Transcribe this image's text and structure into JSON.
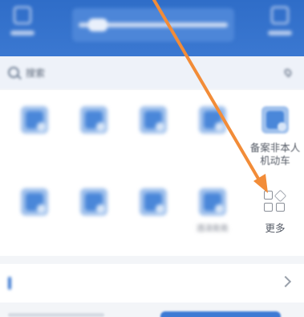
{
  "header": {
    "left_label": "",
    "right_label": "",
    "pill_text": ""
  },
  "search": {
    "placeholder": "搜索",
    "location": ""
  },
  "services": {
    "row1": [
      {
        "label": "",
        "icon": "doc-icon"
      },
      {
        "label": "",
        "icon": "car-icon"
      },
      {
        "label": "",
        "icon": "license-icon"
      },
      {
        "label": "",
        "icon": "report-icon"
      },
      {
        "label": "备案非本人机动车",
        "icon": "vehicle-record-icon"
      }
    ],
    "row2": [
      {
        "label": "",
        "icon": "calendar-icon"
      },
      {
        "label": "",
        "icon": "edit-icon"
      },
      {
        "label": "",
        "icon": "home-icon"
      },
      {
        "label": "违法处处",
        "icon": "card-icon"
      },
      {
        "label": "更多",
        "icon": "grid-more-icon"
      }
    ]
  },
  "notice": {
    "title": "",
    "subtitle": ""
  },
  "colors": {
    "header_blue": "#3b78d1",
    "annotation_orange": "#f28c38"
  }
}
